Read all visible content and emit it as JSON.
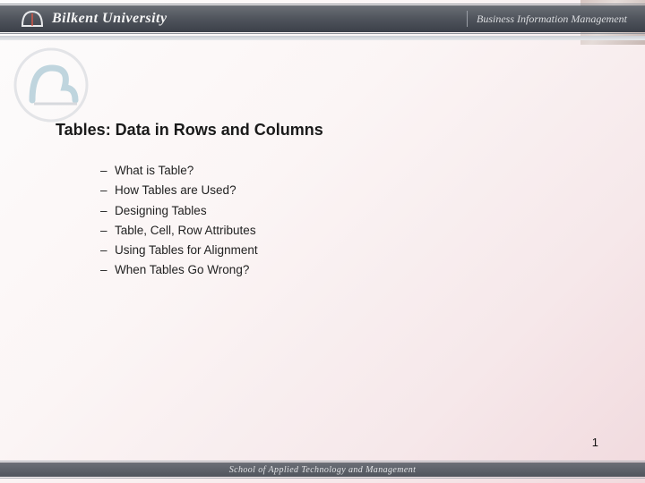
{
  "header": {
    "university_name": "Bilkent University",
    "right_label": "Business Information Management"
  },
  "title": "Tables: Data in Rows and Columns",
  "bullets": [
    "What is Table?",
    "How Tables are Used?",
    "Designing Tables",
    "Table, Cell, Row Attributes",
    "Using Tables for Alignment",
    "When Tables Go Wrong?"
  ],
  "footer": {
    "school": "School of Applied Technology and Management"
  },
  "page_number": "1"
}
